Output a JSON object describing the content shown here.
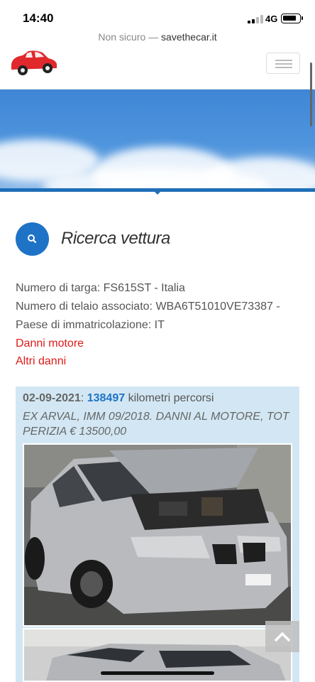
{
  "status_bar": {
    "time": "14:40",
    "network": "4G"
  },
  "url_bar": {
    "prefix": "Non sicuro — ",
    "host": "savethecar.it"
  },
  "header": {
    "logo_icon": "car-icon",
    "menu_icon": "hamburger-icon"
  },
  "section": {
    "title": "Ricerca vettura",
    "icon": "search-icon"
  },
  "vehicle_info": {
    "plate_label": "Numero di targa:",
    "plate_value": "FS615ST - Italia",
    "vin_label": "Numero di telaio associato:",
    "vin_value": "WBA6T51010VE73387 -",
    "country_label": "Paese di immatricolazione:",
    "country_value": "IT"
  },
  "links": {
    "engine_damage": "Danni motore",
    "other_damage": "Altri danni"
  },
  "record": {
    "date": "02-09-2021",
    "colon": ": ",
    "km": "138497",
    "km_suffix": " kilometri percorsi",
    "description": "EX ARVAL, IMM 09/2018. DANNI AL MOTORE, TOT PERIZIA € 13500,00"
  },
  "scroll_top_icon": "chevron-up-icon",
  "colors": {
    "accent": "#1e73c6",
    "danger": "#e01a1a",
    "card_bg": "#d2e7f3"
  }
}
